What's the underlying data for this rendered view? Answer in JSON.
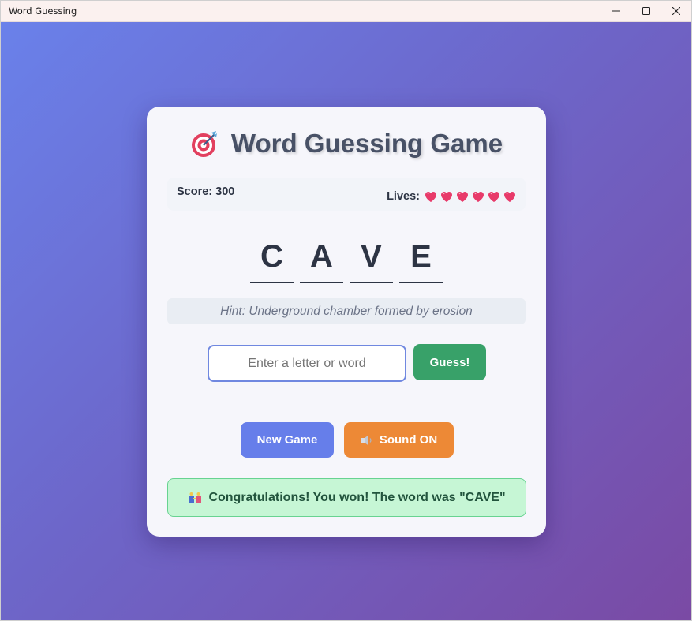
{
  "window": {
    "title": "Word Guessing"
  },
  "game": {
    "title": "Word Guessing Game",
    "title_icon": "target-icon",
    "score_text": "Score: 300",
    "lives_label": "Lives:",
    "lives": 6,
    "heart_icon": "heart-icon",
    "heart_color": "#e83a6a",
    "word_letters": [
      "C",
      "A",
      "V",
      "E"
    ],
    "hint": "Hint: Underground chamber formed by erosion",
    "input_placeholder": "Enter a letter or word",
    "guess_label": "Guess!",
    "new_game_label": "New Game",
    "sound_label": "Sound ON",
    "sound_icon": "speaker-icon",
    "message": "Congratulations! You won! The word was \"CAVE\"",
    "message_icon": "party-icon"
  },
  "colors": {
    "guess_button": "#38a169",
    "new_game_button": "#667eea",
    "sound_button": "#ed8936",
    "success_bg": "#c6f6d5",
    "success_text": "#22543d"
  }
}
